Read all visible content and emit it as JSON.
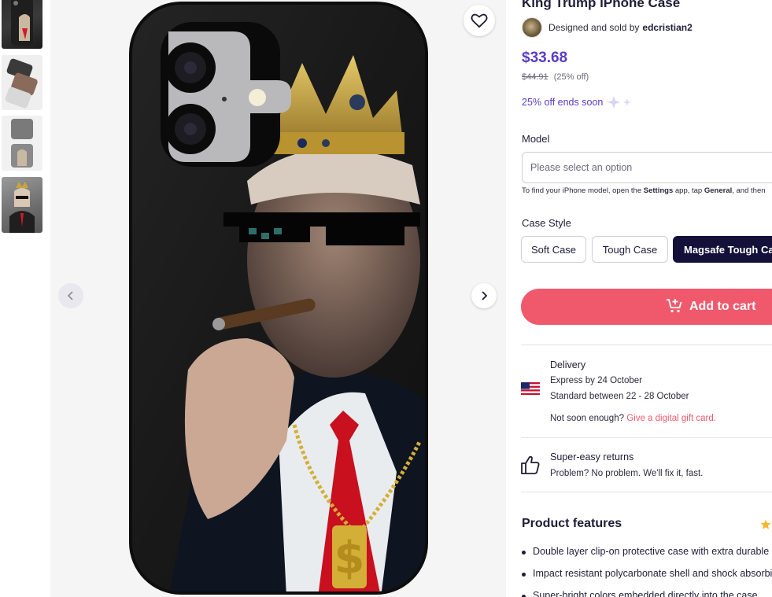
{
  "product": {
    "title": "King Trump iPhone Case",
    "seller_prefix": "Designed and sold by",
    "seller_name": "edcristian2",
    "price": "$33.68",
    "original_price": "$44.91",
    "discount": "(25% off)",
    "promo": "25% off ends soon"
  },
  "options": {
    "model_label": "Model",
    "model_placeholder": "Please select an option",
    "model_hint_1": "To find your iPhone model, open the ",
    "model_hint_settings": "Settings",
    "model_hint_2": " app, tap ",
    "model_hint_general": "General",
    "model_hint_3": ", and then",
    "case_style_label": "Case Style",
    "case_styles": [
      "Soft Case",
      "Tough Case",
      "Magsafe Tough Case"
    ],
    "selected_style": "Magsafe Tough Case"
  },
  "cart": {
    "label": "Add to cart"
  },
  "delivery": {
    "title": "Delivery",
    "express": "Express by 24 October",
    "standard": "Standard between 22 - 28 October",
    "not_soon": "Not soon enough? ",
    "gift_link": "Give a digital gift card."
  },
  "returns": {
    "title": "Super-easy returns",
    "subtitle": "Problem? No problem. We'll fix it, fast."
  },
  "features": {
    "title": "Product features",
    "items": [
      "Double layer clip-on protective case with extra durable",
      "Impact resistant polycarbonate shell and shock absorbing",
      "Super-bright colors embedded directly into the case"
    ]
  },
  "colors": {
    "brand_purple": "#5b3bc4",
    "cart_coral": "#f0596c",
    "selected_chip": "#13103a",
    "text_dark": "#1f1d36"
  },
  "icons": [
    "heart-icon",
    "chevron-left-icon",
    "chevron-right-icon",
    "cart-icon",
    "us-flag-icon",
    "thumbs-up-icon",
    "star-icon",
    "sparkle-icon"
  ]
}
